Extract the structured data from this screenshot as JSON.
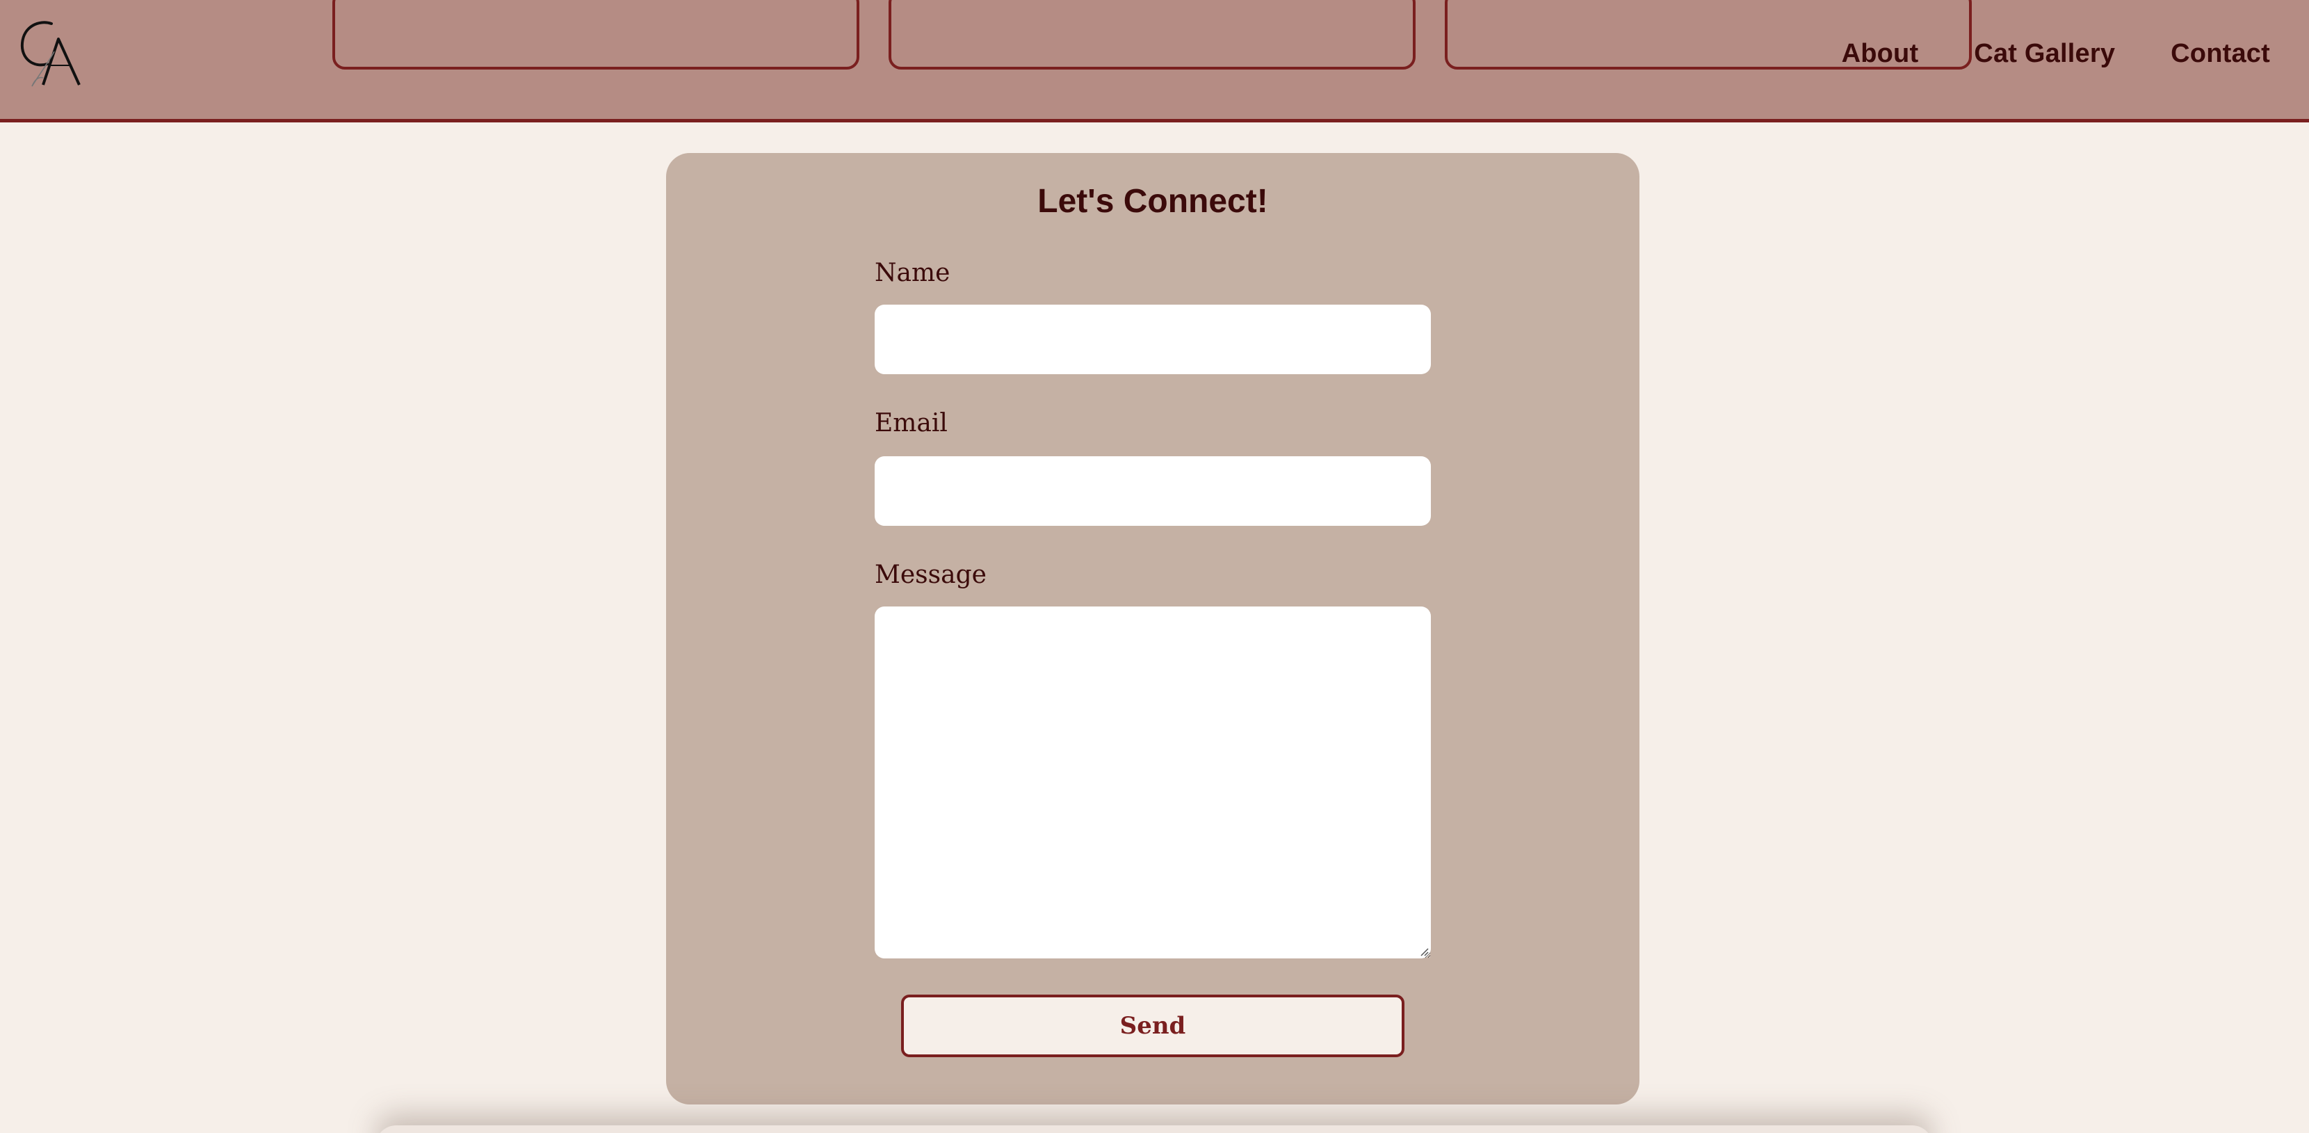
{
  "header": {
    "logo_text": "CA",
    "nav": [
      {
        "label": "About"
      },
      {
        "label": "Cat Gallery"
      },
      {
        "label": "Contact"
      }
    ]
  },
  "contact": {
    "title": "Let's Connect!",
    "fields": {
      "name": {
        "label": "Name",
        "value": "",
        "placeholder": ""
      },
      "email": {
        "label": "Email",
        "value": "",
        "placeholder": ""
      },
      "message": {
        "label": "Message",
        "value": "",
        "placeholder": ""
      }
    },
    "send_label": "Send"
  },
  "colors": {
    "header_bg": "#b58c84",
    "accent": "#7a1f1f",
    "text_dark": "#3b0a0a",
    "card_bg": "#c5b1a4",
    "page_bg": "#f6efe9"
  }
}
